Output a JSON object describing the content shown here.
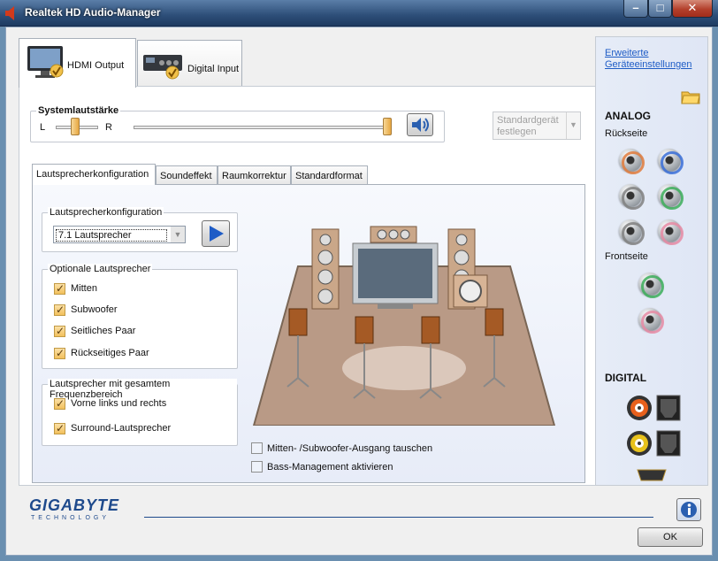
{
  "window": {
    "title": "Realtek HD Audio-Manager"
  },
  "device_tabs": [
    {
      "label": "HDMI Output",
      "icon": "monitor-icon",
      "active": true
    },
    {
      "label": "Digital Input",
      "icon": "receiver-icon",
      "active": false
    }
  ],
  "advanced_link": {
    "line1": "Erweiterte",
    "line2": "Geräteeinstellungen"
  },
  "volume": {
    "title": "Systemlautstärke",
    "left": "L",
    "right": "R",
    "balance_position": 0.5,
    "level_position": 1.0,
    "speaker_icon": "speaker-icon"
  },
  "default_device": {
    "line1": "Standardgerät",
    "line2": "festlegen"
  },
  "tabs": [
    "Lautsprecherkonfiguration",
    "Soundeffekt",
    "Raumkorrektur",
    "Standardformat"
  ],
  "speaker_config": {
    "group_title": "Lautsprecherkonfiguration",
    "selected": "7.1 Lautsprecher",
    "play_icon": "play-icon"
  },
  "optional": {
    "title": "Optionale Lautsprecher",
    "items": [
      {
        "label": "Mitten",
        "checked": true
      },
      {
        "label": "Subwoofer",
        "checked": true
      },
      {
        "label": "Seitliches Paar",
        "checked": true
      },
      {
        "label": "Rückseitiges Paar",
        "checked": true
      }
    ]
  },
  "fullrange": {
    "title": "Lautsprecher mit gesamtem Frequenzbereich",
    "items": [
      {
        "label": "Vorne links und rechts",
        "checked": true
      },
      {
        "label": "Surround-Lautsprecher",
        "checked": true
      }
    ]
  },
  "options": [
    {
      "label": "Mitten- /Subwoofer-Ausgang tauschen",
      "checked": false
    },
    {
      "label": "Bass-Management aktivieren",
      "checked": false
    }
  ],
  "analog": {
    "title": "ANALOG",
    "rear": "Rückseite",
    "front": "Frontseite",
    "folder_icon": "folder-icon"
  },
  "digital": {
    "title": "DIGITAL"
  },
  "footer": {
    "brand": "GIGABYTE",
    "brand_sub": "TECHNOLOGY",
    "info_icon": "info-icon",
    "ok": "OK"
  },
  "colors": {
    "jack_orange": "#e07b3c",
    "jack_blue": "#3a6fd8",
    "jack_gray": "#808080",
    "jack_green": "#3cae5a",
    "jack_pink": "#e68aa3",
    "accent": "#1e5cc6"
  }
}
